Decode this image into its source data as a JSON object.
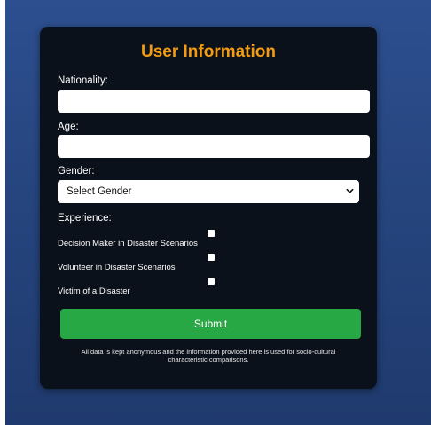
{
  "form": {
    "title": "User Information",
    "nationality": {
      "label": "Nationality:",
      "value": "",
      "placeholder": ""
    },
    "age": {
      "label": "Age:",
      "value": "",
      "placeholder": ""
    },
    "gender": {
      "label": "Gender:",
      "selected": "Select Gender",
      "icon": "chevron-down-icon"
    },
    "experience": {
      "label": "Experience:",
      "options": [
        {
          "label": "Decision Maker in Disaster Scenarios",
          "checked": false
        },
        {
          "label": "Volunteer in Disaster Scenarios",
          "checked": false
        },
        {
          "label": "Victim of a Disaster",
          "checked": false
        }
      ]
    },
    "submit_label": "Submit",
    "footnote_line1": "All data is kept anonymous and the information provided here is used for socio-cultural",
    "footnote_line2": "characteristic comparisons."
  },
  "colors": {
    "background": "#26457f",
    "card": "#0b111b",
    "title": "#f39c12",
    "submit": "#28a745"
  }
}
